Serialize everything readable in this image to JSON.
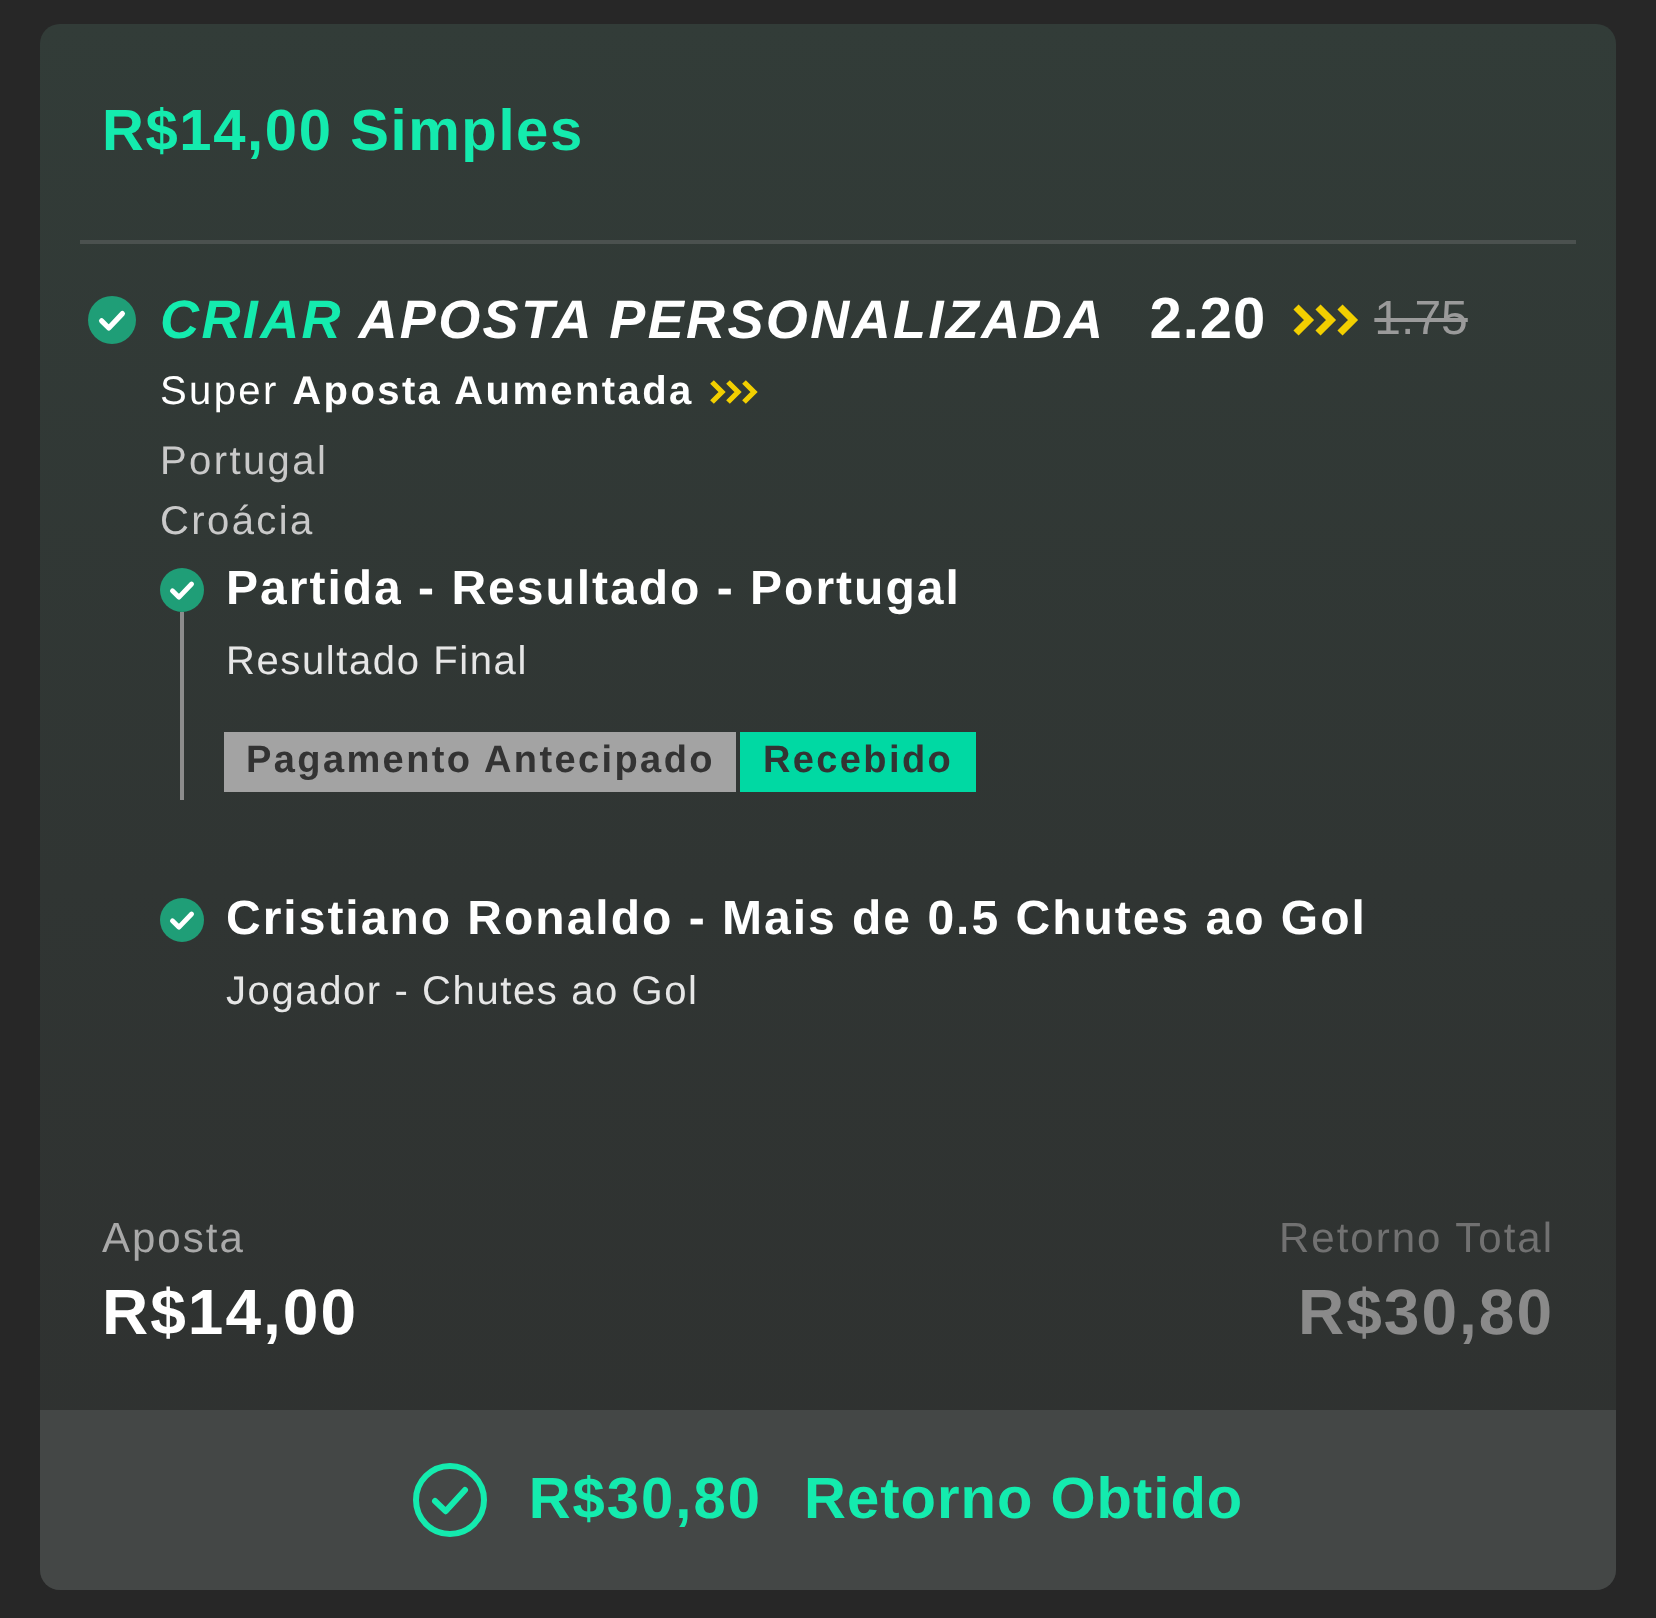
{
  "bet_summary": {
    "title": "R$14,00 Simples"
  },
  "bet": {
    "won": true,
    "title_prefix": "CRIAR",
    "title": "APOSTA PERSONALIZADA",
    "odds": "2.20",
    "previous_odds": "1.75",
    "boost": "Super **Aposta Aumentada**",
    "teams": [
      "Portugal",
      "Croácia"
    ],
    "selections": [
      {
        "won": true,
        "name": "Partida - Resultado - Portugal",
        "market": "Resultado Final",
        "badges": [
          {
            "text": "Pagamento Antecipado",
            "color": "#a3a3a3"
          },
          {
            "text": "Recebido",
            "color": "#00d9a3"
          }
        ]
      },
      {
        "won": true,
        "name": "Cristiano Ronaldo - Mais de 0.5 Chutes ao Gol",
        "market": "Jogador - Chutes ao Gol"
      }
    ]
  },
  "totals": {
    "stake_label": "Aposta",
    "stake": "R$14,00",
    "return_label": "Retorno Total",
    "return": "R$30,80"
  },
  "outcome": {
    "won": true,
    "amount": "R$30,80",
    "label": "Retorno Obtido"
  }
}
